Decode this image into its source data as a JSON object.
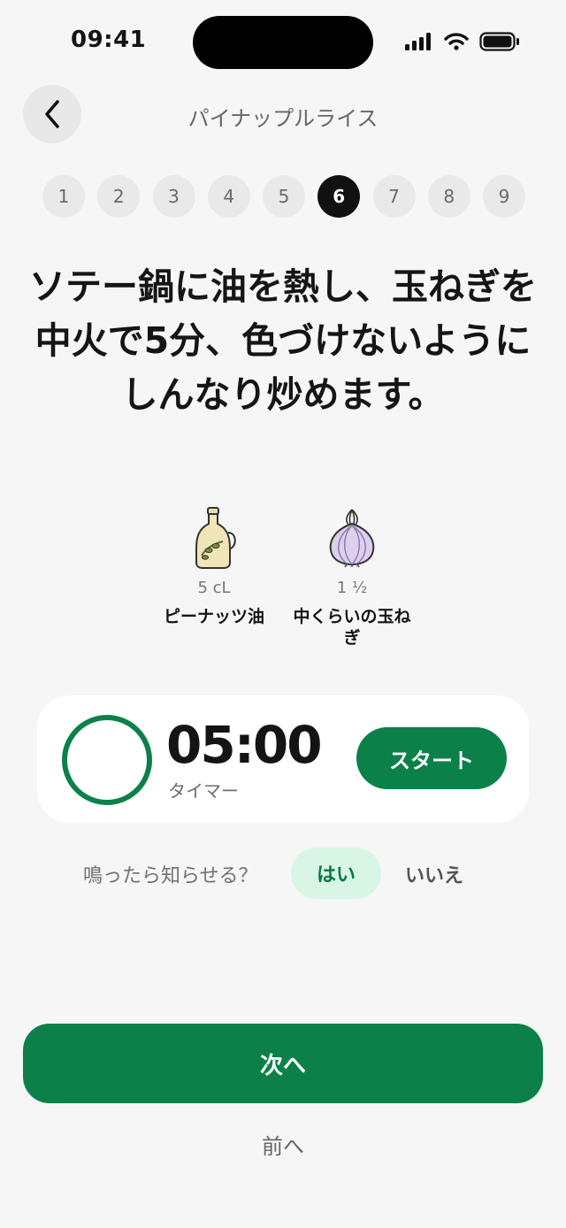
{
  "status_bar": {
    "time": "09:41"
  },
  "header": {
    "title": "パイナップルライス"
  },
  "steps": [
    "1",
    "2",
    "3",
    "4",
    "5",
    "6",
    "7",
    "8",
    "9"
  ],
  "current_step": "6",
  "instruction": "ソテー鍋に油を熱し、玉ねぎを中火で5分、色づけないようにしんなり炒めます。",
  "ingredients": [
    {
      "quantity": "5 cL",
      "name": "ピーナッツ油",
      "icon": "oil-bottle-icon"
    },
    {
      "quantity": "1 ½",
      "name": "中くらいの玉ねぎ",
      "icon": "onion-icon"
    }
  ],
  "timer": {
    "value": "05:00",
    "label": "タイマー",
    "start_label": "スタート",
    "progress": 0
  },
  "notify": {
    "question": "鳴ったら知らせる？",
    "yes": "はい",
    "no": "いいえ",
    "selected": "yes"
  },
  "footer": {
    "next_label": "次へ",
    "prev_label": "前へ"
  },
  "colors": {
    "accent": "#0b8149",
    "accent_light": "#d9f5e6",
    "background": "#f6f6f6"
  }
}
